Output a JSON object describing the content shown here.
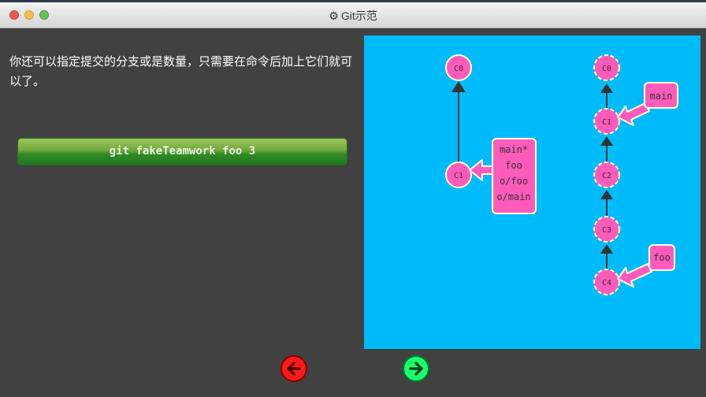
{
  "window": {
    "title": "Git示范"
  },
  "description": "你还可以指定提交的分支或是数量，只需要在命令后加上它们就可以了。",
  "command": "git fakeTeamwork foo 3",
  "left_graph": {
    "commits": [
      "C0",
      "C1"
    ],
    "branch_label": [
      "main*",
      "foo",
      "o/foo",
      "o/main"
    ]
  },
  "right_graph": {
    "commits": [
      "C0",
      "C1",
      "C2",
      "C3",
      "C4"
    ],
    "main_label": "main",
    "foo_label": "foo"
  },
  "nav": {
    "back_icon": "arrow-left-icon",
    "forward_icon": "arrow-right-icon"
  },
  "colors": {
    "viz_background": "#00bbf9",
    "commit_fill": "#ff5bbb",
    "command_button": "#4a9a2e",
    "back_button": "#ff1a1a",
    "forward_button": "#1aff6a"
  }
}
